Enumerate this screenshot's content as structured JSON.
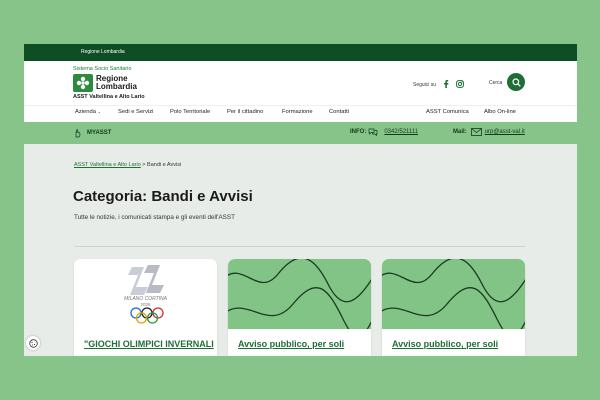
{
  "topbar": {
    "label": "Regione Lombardia"
  },
  "header": {
    "network": "Sistema Socio Sanitario",
    "logo_line1": "Regione",
    "logo_line2": "Lombardia",
    "org_name": "ASST Valtellina e Alto Lario",
    "follow_label": "Seguici su",
    "search_label": "Cerca",
    "icons": [
      "facebook-icon",
      "instagram-icon",
      "search-icon"
    ]
  },
  "nav": {
    "items": [
      "Azienda",
      "Sedi e Servizi",
      "Polo Territoriale",
      "Per il cittadino",
      "Formazione",
      "Contatti",
      "ASST Comunica",
      "Albo On-line"
    ]
  },
  "infobar": {
    "myasst": "MYASST",
    "info_label": "INFO:",
    "phone": "0342/521111",
    "mail_label": "Mail:",
    "email": "urp@asst-val.it"
  },
  "breadcrumb": {
    "home": "ASST Valtellina e Alto Lario",
    "separator": ">",
    "current": "Bandi e Avvisi"
  },
  "page": {
    "title": "Categoria: Bandi e Avvisi",
    "subtitle": "Tutte le notizie, i comunicati stampa e gli eventi dell'ASST"
  },
  "cards": [
    {
      "title": "\"GIOCHI OLIMPICI INVERNALI",
      "logo_text": "MILANO CORTINA",
      "logo_year": "2026"
    },
    {
      "title": "Avviso pubblico, per soli"
    },
    {
      "title": "Avviso pubblico, per soli"
    }
  ],
  "colors": {
    "brand_dark": "#0f4d24",
    "brand": "#1f6e35",
    "accent_light": "#87c48a"
  }
}
